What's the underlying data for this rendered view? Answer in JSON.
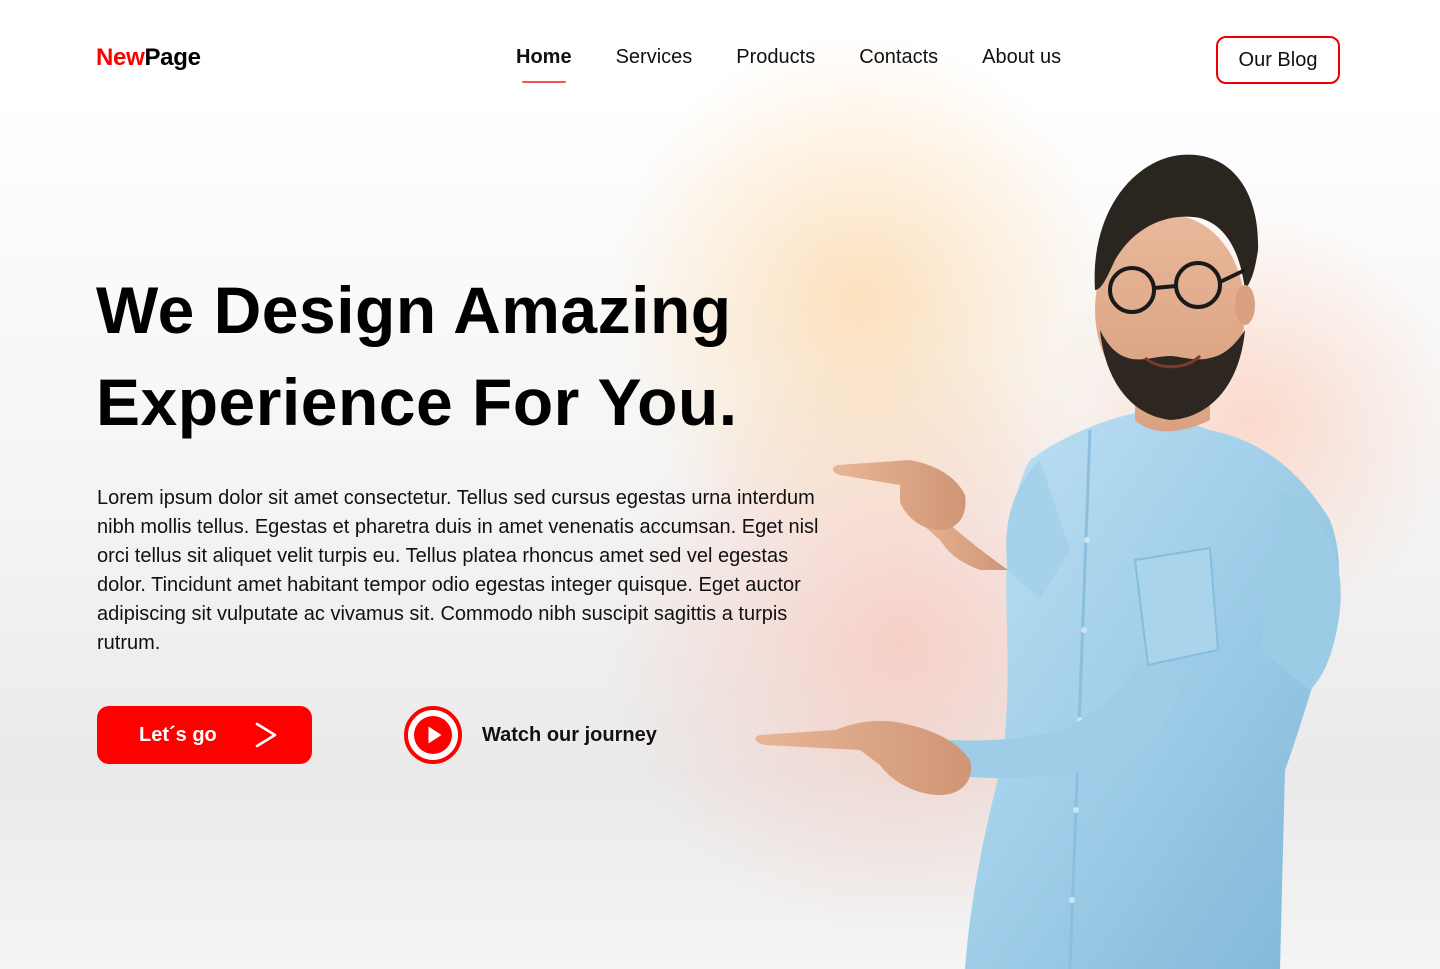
{
  "logo": {
    "part1": "New",
    "part2": "Page"
  },
  "nav": {
    "items": [
      {
        "label": "Home",
        "active": true
      },
      {
        "label": "Services",
        "active": false
      },
      {
        "label": "Products",
        "active": false
      },
      {
        "label": "Contacts",
        "active": false
      },
      {
        "label": "About us",
        "active": false
      }
    ]
  },
  "header": {
    "blog_label": "Our Blog"
  },
  "hero": {
    "title_line1": "We Design Amazing",
    "title_line2": "Experience For You.",
    "body": "Lorem ipsum dolor sit amet consectetur. Tellus sed cursus egestas urna interdum nibh mollis tellus. Egestas et pharetra duis in amet venenatis accumsan. Eget nisl orci tellus sit aliquet velit turpis eu. Tellus platea rhoncus amet sed vel egestas dolor. Tincidunt amet habitant tempor odio egestas integer quisque. Eget auctor adipiscing sit vulputate ac vivamus sit. Commodo nibh suscipit sagittis a turpis rutrum.",
    "cta_label": "Let´s go",
    "watch_label": "Watch our journey"
  },
  "icons": {
    "cta_arrow": "chevron-right-icon",
    "watch": "play-icon"
  },
  "colors": {
    "brand_red": "#ff0000",
    "nav_underline": "#f25555",
    "text": "#000000"
  }
}
